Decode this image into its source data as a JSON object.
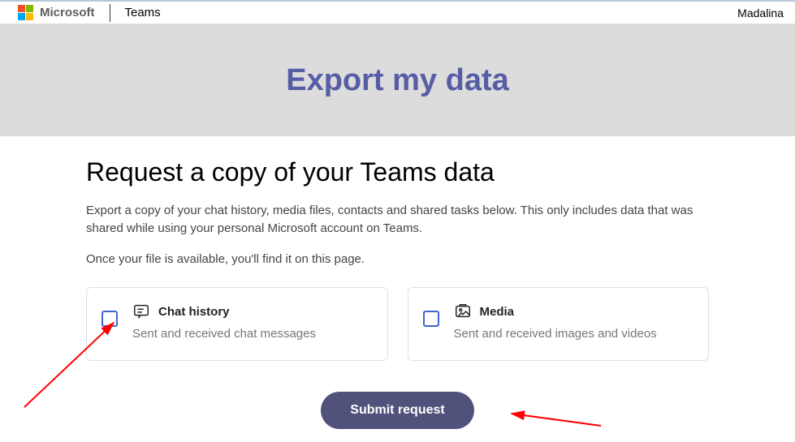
{
  "topbar": {
    "brand": "Microsoft",
    "product": "Teams",
    "user": "Madalina"
  },
  "banner": {
    "title": "Export my data"
  },
  "main": {
    "heading": "Request a copy of your Teams data",
    "description1": "Export a copy of your chat history, media files, contacts and shared tasks below. This only includes data that was shared while using your personal Microsoft account on Teams.",
    "description2": "Once your file is available, you'll find it on this page."
  },
  "options": [
    {
      "title": "Chat history",
      "subtitle": "Sent and received chat messages"
    },
    {
      "title": "Media",
      "subtitle": "Sent and received images and videos"
    }
  ],
  "submit_label": "Submit request",
  "annotations": {
    "arrow_color": "#ff0000"
  }
}
